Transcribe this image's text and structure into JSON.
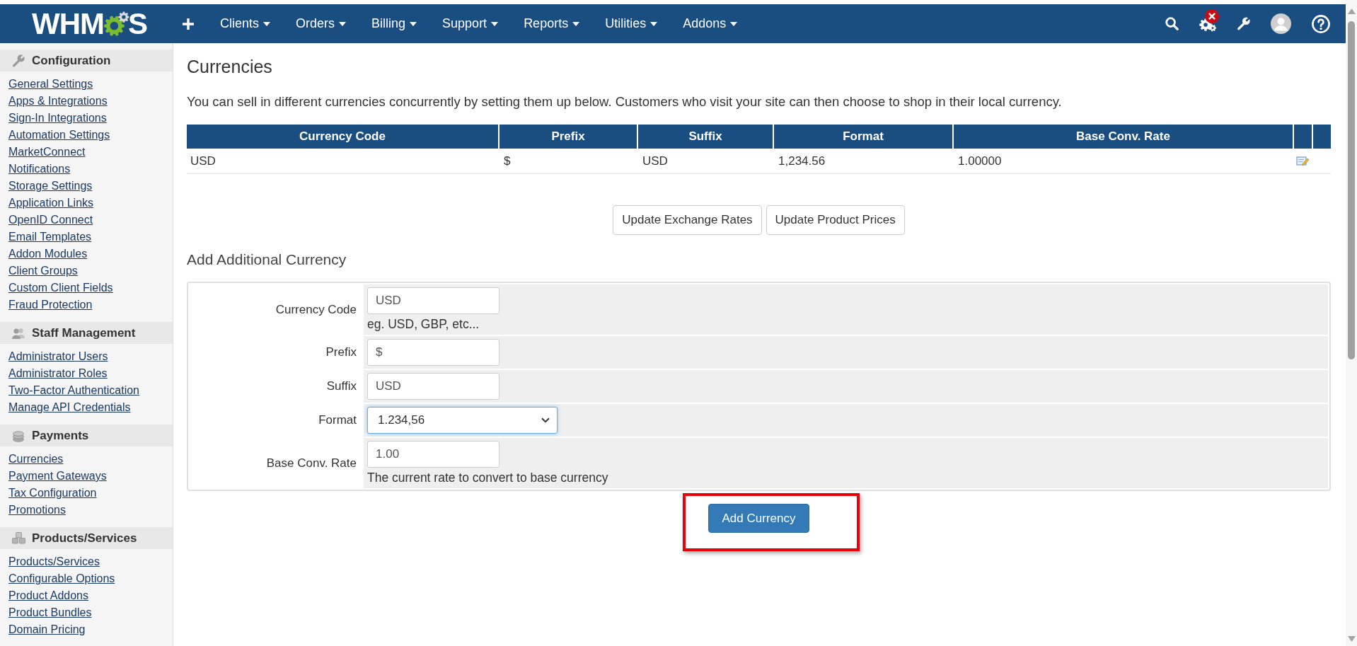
{
  "navbar": {
    "logo": {
      "before_gear": "WHM",
      "after_gear": "S"
    },
    "menus": [
      "Clients",
      "Orders",
      "Billing",
      "Support",
      "Reports",
      "Utilities",
      "Addons"
    ],
    "system_alert": true
  },
  "sidebar": {
    "sections": [
      {
        "title": "Configuration",
        "links": [
          "General Settings",
          "Apps & Integrations",
          "Sign-In Integrations",
          "Automation Settings",
          "MarketConnect",
          "Notifications",
          "Storage Settings",
          "Application Links",
          "OpenID Connect",
          "Email Templates",
          "Addon Modules",
          "Client Groups",
          "Custom Client Fields",
          "Fraud Protection"
        ]
      },
      {
        "title": "Staff Management",
        "links": [
          "Administrator Users",
          "Administrator Roles",
          "Two-Factor Authentication",
          "Manage API Credentials"
        ]
      },
      {
        "title": "Payments",
        "links": [
          "Currencies",
          "Payment Gateways",
          "Tax Configuration",
          "Promotions"
        ]
      },
      {
        "title": "Products/Services",
        "links": [
          "Products/Services",
          "Configurable Options",
          "Product Addons",
          "Product Bundles",
          "Domain Pricing"
        ]
      }
    ]
  },
  "page": {
    "title": "Currencies",
    "intro": "You can sell in different currencies concurrently by setting them up below. Customers who visit your site can then choose to shop in their local currency."
  },
  "currency_table": {
    "columns": [
      "Currency Code",
      "Prefix",
      "Suffix",
      "Format",
      "Base Conv. Rate"
    ],
    "rows": [
      {
        "cells": [
          "USD",
          "$",
          "USD",
          "1,234.56",
          "1.00000"
        ]
      }
    ]
  },
  "actions": [
    "Update Exchange Rates",
    "Update Product Prices"
  ],
  "add_form": {
    "title": "Add Additional Currency",
    "fields": [
      {
        "label": "Currency Code",
        "kind": "text",
        "value": "USD",
        "hint": "eg. USD, GBP, etc...",
        "focused": false
      },
      {
        "label": "Prefix",
        "kind": "text",
        "value": "$",
        "focused": false
      },
      {
        "label": "Suffix",
        "kind": "text",
        "value": "USD",
        "focused": false
      },
      {
        "label": "Format",
        "kind": "select",
        "value": "1.234,56",
        "focused": true
      },
      {
        "label": "Base Conv. Rate",
        "kind": "text",
        "value": "1.00",
        "hint": "The current rate to convert to base currency",
        "focused": false
      }
    ],
    "submit": {
      "label": "Add Currency",
      "highlighted": true
    }
  }
}
